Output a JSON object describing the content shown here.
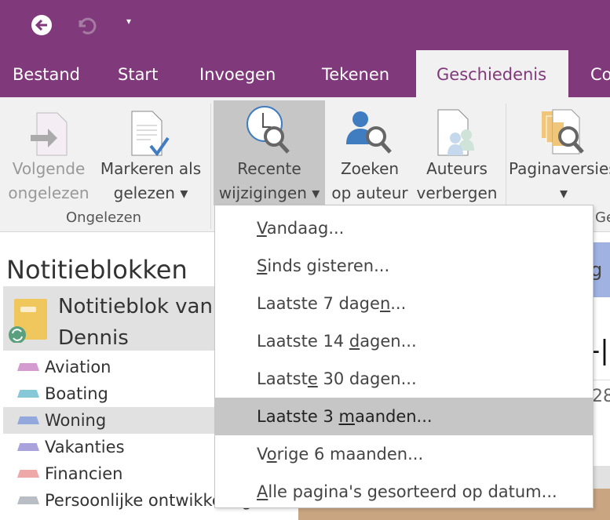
{
  "colors": {
    "brand": "#80397b",
    "highlight": "#c6c6c6"
  },
  "titlebar": {
    "back_icon": "back-arrow-circle-icon",
    "undo_icon": "undo-icon",
    "qat_icon": "customize-dropdown-icon"
  },
  "tabs": [
    "Bestand",
    "Start",
    "Invoegen",
    "Tekenen",
    "Geschiedenis",
    "Co"
  ],
  "active_tab": "Geschiedenis",
  "ribbon": {
    "buttons": [
      {
        "l1": "Volgende",
        "l2": "ongelezen",
        "icon": "next-unread-icon",
        "enabled": false
      },
      {
        "l1": "Markeren als",
        "l2": "gelezen ▾",
        "icon": "mark-read-icon"
      },
      {
        "l1": "Recente",
        "l2": "wijzigingen ▾",
        "icon": "recent-changes-icon",
        "pressed": true
      },
      {
        "l1": "Zoeken",
        "l2": "op auteur",
        "icon": "find-author-icon"
      },
      {
        "l1": "Auteurs",
        "l2": "verbergen",
        "icon": "hide-authors-icon"
      },
      {
        "l1": "Paginaversies",
        "l2": "▾",
        "icon": "page-versions-icon"
      }
    ],
    "groups": [
      "Ongelezen",
      "Ges"
    ]
  },
  "sidebar": {
    "heading": "Notitieblokken",
    "notebook": {
      "line1": "Notitieblok van",
      "line2": "Dennis",
      "icon": "notebook-sync-icon"
    },
    "sections": [
      {
        "label": "Aviation",
        "color": "#d39bd0"
      },
      {
        "label": "Boating",
        "color": "#86c8d8"
      },
      {
        "label": "Woning",
        "color": "#93a8dc",
        "selected": true
      },
      {
        "label": "Vakanties",
        "color": "#aaa2dc"
      },
      {
        "label": "Financien",
        "color": "#eea8a8"
      },
      {
        "label": "Persoonlijke ontwikkeling",
        "color": "#b8bec4"
      }
    ]
  },
  "content": {
    "tab_fragment": "g",
    "title_fragment": "-|",
    "date_fragment": "28"
  },
  "menu": {
    "items": [
      {
        "pre": "",
        "key": "V",
        "post": "andaag..."
      },
      {
        "pre": "",
        "key": "S",
        "post": "inds gisteren..."
      },
      {
        "pre": "Laatste 7 dage",
        "key": "n",
        "post": "..."
      },
      {
        "pre": "Laatste 14 ",
        "key": "d",
        "post": "agen..."
      },
      {
        "pre": "Laatst",
        "key": "e",
        "post": " 30 dagen..."
      },
      {
        "pre": "Laatste 3 ",
        "key": "m",
        "post": "aanden...",
        "highlighted": true
      },
      {
        "pre": "V",
        "key": "o",
        "post": "rige 6 maanden..."
      },
      {
        "pre": "",
        "key": "A",
        "post": "lle pagina's gesorteerd op datum..."
      }
    ]
  }
}
